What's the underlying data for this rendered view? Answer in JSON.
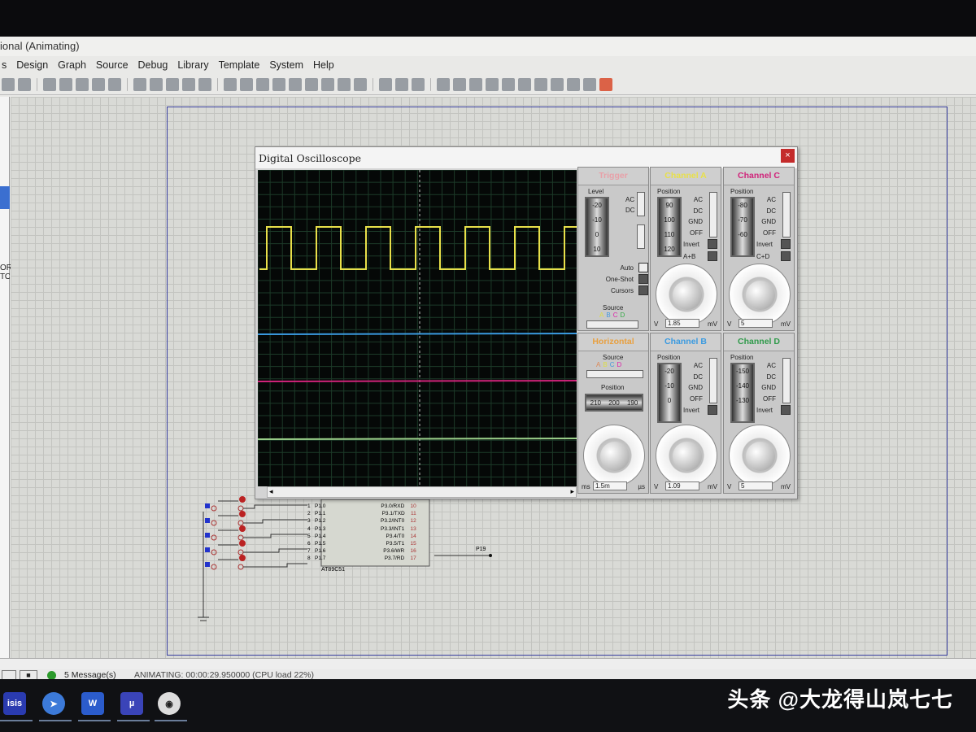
{
  "window": {
    "title": "ional (Animating)"
  },
  "menu": [
    "s",
    "Design",
    "Graph",
    "Source",
    "Debug",
    "Library",
    "Template",
    "System",
    "Help"
  ],
  "leftbar": {
    "text1": "OR",
    "text2": "TOF"
  },
  "oscilloscope": {
    "title": "Digital Oscilloscope",
    "close": "×",
    "trigger": {
      "title": "Trigger",
      "level_label": "Level",
      "level_ticks": [
        "-20",
        "-10",
        "0",
        "10"
      ],
      "coupling": [
        "AC",
        "DC"
      ],
      "buttons": [
        "Auto",
        "One-Shot",
        "Cursors"
      ],
      "source_label": "Source",
      "sources": [
        "A",
        "B",
        "C",
        "D"
      ]
    },
    "channel_a": {
      "title": "Channel A",
      "position_label": "Position",
      "ticks": [
        "90",
        "100",
        "110",
        "120"
      ],
      "coupling": [
        "AC",
        "DC",
        "GND",
        "OFF"
      ],
      "buttons": [
        "Invert",
        "A+B"
      ],
      "readout": "1.85",
      "unit_left": "V",
      "unit_right": "mV",
      "color": "#e8e04a"
    },
    "channel_c": {
      "title": "Channel C",
      "position_label": "Position",
      "ticks": [
        "-80",
        "-70",
        "-60"
      ],
      "coupling": [
        "AC",
        "DC",
        "GND",
        "OFF"
      ],
      "buttons": [
        "Invert",
        "C+D"
      ],
      "readout": "5",
      "unit_left": "V",
      "unit_right": "mV",
      "color": "#d0237a"
    },
    "horizontal": {
      "title": "Horizontal",
      "source_label": "Source",
      "sources": [
        "A",
        "B",
        "C",
        "D"
      ],
      "position_label": "Position",
      "ticks": [
        "210",
        "200",
        "190"
      ],
      "readout": "1.5m",
      "unit_left": "ms",
      "unit_right": "µs",
      "color": "#e8a040"
    },
    "channel_b": {
      "title": "Channel B",
      "position_label": "Position",
      "ticks": [
        "-20",
        "-10",
        "0"
      ],
      "coupling": [
        "AC",
        "DC",
        "GND",
        "OFF"
      ],
      "buttons": [
        "Invert"
      ],
      "readout": "1.09",
      "unit_left": "V",
      "unit_right": "mV",
      "color": "#3a9ae0"
    },
    "channel_d": {
      "title": "Channel D",
      "position_label": "Position",
      "ticks": [
        "-150",
        "-140",
        "-130"
      ],
      "coupling": [
        "AC",
        "DC",
        "GND",
        "OFF"
      ],
      "buttons": [
        "Invert"
      ],
      "readout": "5",
      "unit_left": "V",
      "unit_right": "mV",
      "color": "#2f9a4a"
    }
  },
  "schematic": {
    "chip": "AT89C51",
    "left_pins": [
      {
        "n": "1",
        "name": "P1.0"
      },
      {
        "n": "2",
        "name": "P1.1"
      },
      {
        "n": "3",
        "name": "P1.2"
      },
      {
        "n": "4",
        "name": "P1.3"
      },
      {
        "n": "5",
        "name": "P1.4"
      },
      {
        "n": "6",
        "name": "P1.5"
      },
      {
        "n": "7",
        "name": "P1.6"
      },
      {
        "n": "8",
        "name": "P1.7"
      }
    ],
    "right_pins": [
      {
        "n": "10",
        "name": "P3.0/RXD"
      },
      {
        "n": "11",
        "name": "P3.1/TXD"
      },
      {
        "n": "12",
        "name": "P3.2/INT0"
      },
      {
        "n": "13",
        "name": "P3.3/INT1"
      },
      {
        "n": "14",
        "name": "P3.4/T0"
      },
      {
        "n": "15",
        "name": "P3.5/T1"
      },
      {
        "n": "16",
        "name": "P3.6/WR"
      },
      {
        "n": "17",
        "name": "P3.7/RD"
      }
    ],
    "net_label": "P19"
  },
  "status": {
    "messages": "5 Message(s)",
    "animation": "ANIMATING: 00:00:29.950000 (CPU load 22%)"
  },
  "taskbar": {
    "isis": "isis",
    "wps": "W"
  },
  "watermark": "头条 @大龙得山岚七七"
}
